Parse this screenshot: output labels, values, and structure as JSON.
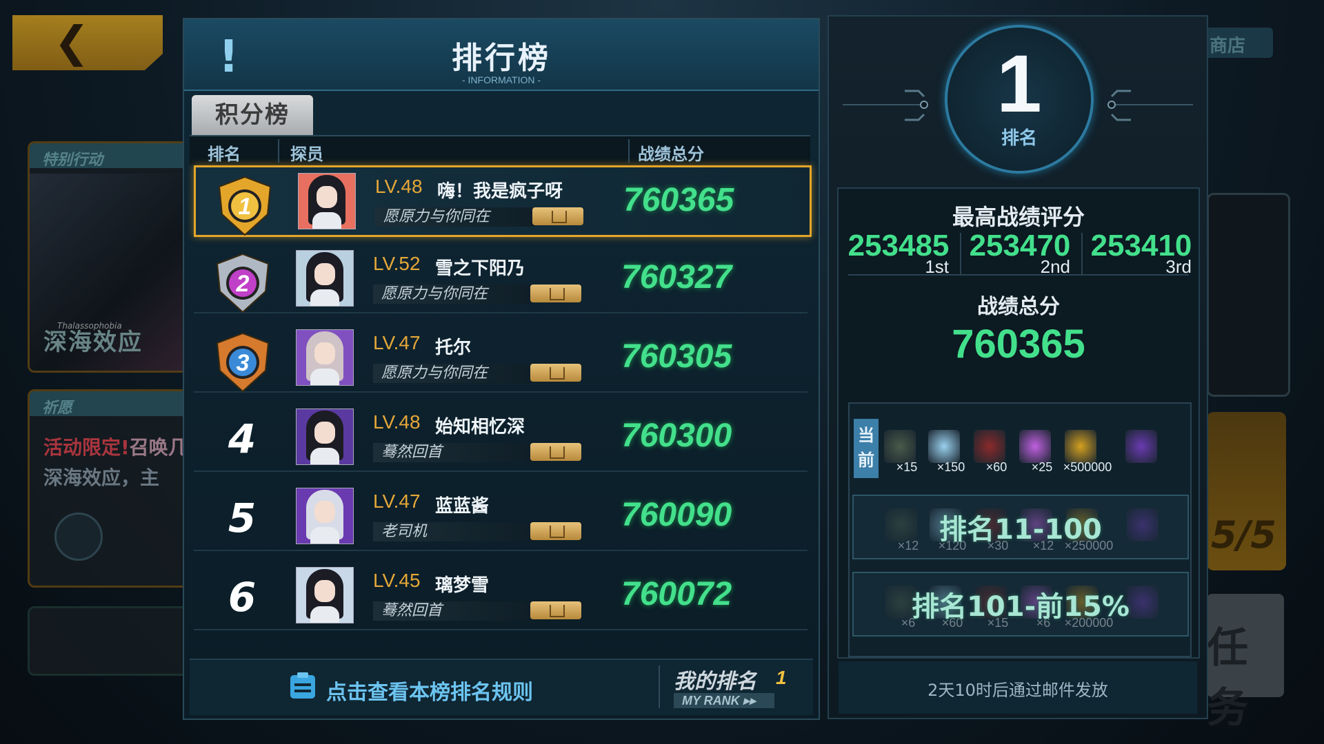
{
  "header": {
    "title": "排行榜",
    "subtitle": "- INFORMATION -",
    "tab": "积分榜"
  },
  "columns": {
    "rank": "排名",
    "member": "探员",
    "score": "战绩总分"
  },
  "leaderboard": [
    {
      "rank": "1",
      "level": "LV.48",
      "name": "嗨！我是疯子呀",
      "guild": "愿原力与你同在",
      "score": "760365",
      "hair": "#1c1c24"
    },
    {
      "rank": "2",
      "level": "LV.52",
      "name": "雪之下阳乃",
      "guild": "愿原力与你同在",
      "score": "760327",
      "hair": "#1c1c24"
    },
    {
      "rank": "3",
      "level": "LV.47",
      "name": "托尔",
      "guild": "愿原力与你同在",
      "score": "760305",
      "hair": "#cfc3c8"
    },
    {
      "rank": "4",
      "level": "LV.48",
      "name": "始知相忆深",
      "guild": "蓦然回首",
      "score": "760300",
      "hair": "#1c1c24"
    },
    {
      "rank": "5",
      "level": "LV.47",
      "name": "蓝蓝酱",
      "guild": "老司机",
      "score": "760090",
      "hair": "#d8dce8"
    },
    {
      "rank": "6",
      "level": "LV.45",
      "name": "璃梦雪",
      "guild": "蓦然回首",
      "score": "760072",
      "hair": "#1c1c24"
    }
  ],
  "footer": {
    "rules": "点击查看本榜排名规则",
    "my_rank_label": "我的排名",
    "my_rank_value": "1",
    "my_rank_en": "MY RANK ▸▸"
  },
  "panel": {
    "rank": "1",
    "rank_label": "排名",
    "best_title": "最高战绩评分",
    "best_scores": [
      {
        "value": "253485",
        "ordinal": "1st"
      },
      {
        "value": "253470",
        "ordinal": "2nd"
      },
      {
        "value": "253410",
        "ordinal": "3rd"
      }
    ],
    "total_label": "战绩总分",
    "total_value": "760365",
    "current_tag": "当前",
    "tiers": [
      {
        "label": "",
        "quantities": [
          "×15",
          "×150",
          "×60",
          "×25",
          "×500000",
          ""
        ]
      },
      {
        "label": "排名11-100",
        "quantities": [
          "×12",
          "×120",
          "×30",
          "×12",
          "×250000",
          ""
        ]
      },
      {
        "label": "排名101-前15%",
        "quantities": [
          "×6",
          "×60",
          "×15",
          "×6",
          "×200000",
          ""
        ]
      }
    ],
    "mail_note": "2天10时后通过邮件发放"
  },
  "background": {
    "shop": "商店",
    "event_header": "特别行动",
    "event_title": "深海效应",
    "event_sub": "Thalassophobia",
    "wish_header": "祈愿",
    "wish_line1_red": "活动限定!",
    "wish_line1_rest": "召唤几",
    "wish_line2": "深海效应，主",
    "progress": "5/5",
    "task": "任务"
  },
  "colors": {
    "accent": "#43e08c",
    "gold": "#e4a62a",
    "level": "#e6a838",
    "ui_blue": "#6cc4f0"
  }
}
